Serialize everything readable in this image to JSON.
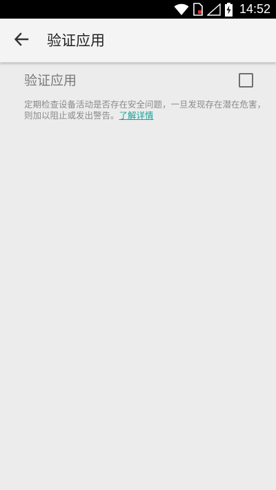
{
  "status_bar": {
    "time": "14:52",
    "icons": [
      "wifi-icon",
      "sim-card-icon",
      "cell-signal-icon",
      "battery-charging-icon"
    ]
  },
  "app_bar": {
    "back_icon": "arrow-left-icon",
    "title": "验证应用"
  },
  "setting": {
    "title": "验证应用",
    "checked": false,
    "summary": "定期检查设备活动是否存在安全问题，一旦发现存在潜在危害，则加以阻止或发出警告。",
    "learn_more": "了解详情"
  },
  "colors": {
    "background": "#ececec",
    "app_bar": "#f4f4f4",
    "status_bar": "#000000",
    "link": "#1aa39a",
    "title_text": "#222222",
    "secondary_text": "#8a8a8a"
  }
}
